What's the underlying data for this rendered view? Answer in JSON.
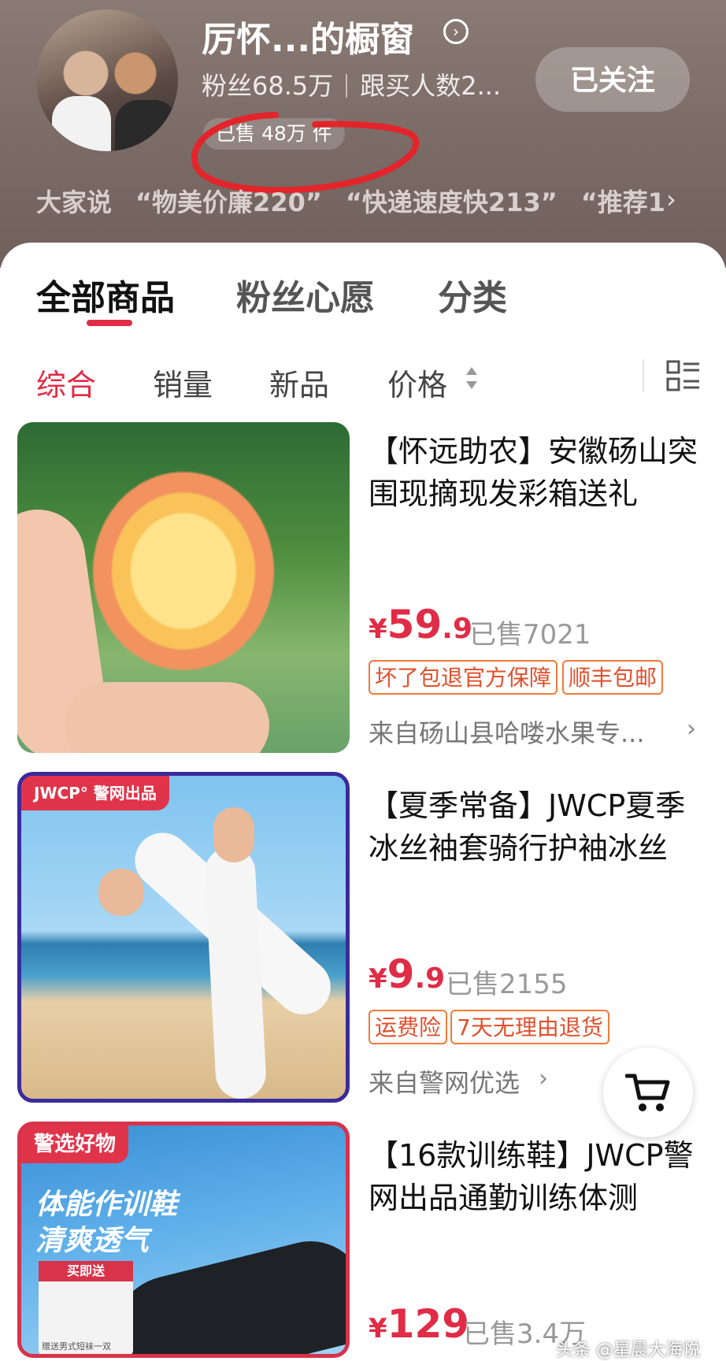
{
  "header": {
    "shop_name": "厉怀...的橱窗",
    "fans": "粉丝68.5万",
    "followers_buy": "跟买人数2...",
    "follow_button": "已关注",
    "sold_badge": "已售 48万 件",
    "reviews_label": "大家说",
    "reviews": [
      "“物美价廉220”",
      "“快递速度快213”",
      "“推荐1"
    ]
  },
  "tabs": [
    {
      "label": "全部商品",
      "active": true
    },
    {
      "label": "粉丝心愿",
      "active": false
    },
    {
      "label": "分类",
      "active": false
    }
  ],
  "sort": [
    "综合",
    "销量",
    "新品",
    "价格"
  ],
  "products": [
    {
      "title": "【怀远助农】安徽砀山突围现摘现发彩箱送礼",
      "price_symbol": "¥",
      "price_int": "59",
      "price_dec": ".9",
      "sold": "已售7021",
      "tags": [
        "坏了包退官方保障",
        "顺丰包邮"
      ],
      "source": "来自砀山县哈喽水果专...",
      "image": "peach-photo"
    },
    {
      "title": "【夏季常备】JWCP夏季冰丝袖套骑行护袖冰丝",
      "price_symbol": "¥",
      "price_int": "9",
      "price_dec": ".9",
      "sold": "已售2155",
      "tags": [
        "运费险",
        "7天无理由退货"
      ],
      "source": "来自警网优选",
      "image_logo": "JWCP° 警网出品",
      "image": "arm-sleeves-photo"
    },
    {
      "title": "【16款训练鞋】JWCP警网出品通勤训练体测",
      "price_symbol": "¥",
      "price_int": "129",
      "price_dec": "",
      "sold": "已售3.4万",
      "image_badge": "警选好物",
      "image_slogan_1": "体能作训鞋",
      "image_slogan_2": "清爽透气",
      "gift_tag": "买即送",
      "gift_text": "赠送男式短袜一双",
      "image": "training-shoe-photo"
    }
  ],
  "watermark": "头条 @星晨大海悦",
  "colors": {
    "accent": "#e02c46",
    "tag_border": "#f07a3a"
  },
  "icons": [
    "info-icon",
    "chevron-right-icon",
    "sort-arrows-icon",
    "layout-list-icon",
    "cart-icon"
  ]
}
